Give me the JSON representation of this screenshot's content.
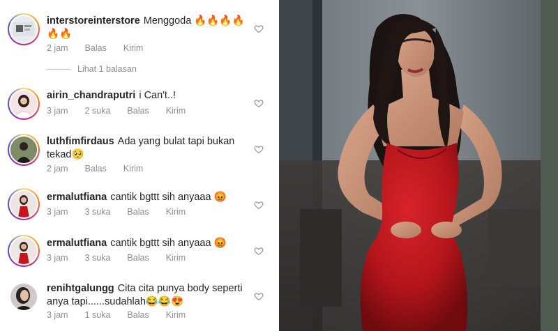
{
  "comments": [
    {
      "username": "interstoreinterstore",
      "text": "Menggoda 🔥🔥🔥🔥🔥🔥",
      "time": "2 jam",
      "likes": "",
      "reply": "Balas",
      "send": "Kirim"
    },
    {
      "username": "airin_chandraputri",
      "text": "i Can't..!",
      "time": "3 jam",
      "likes": "2 suka",
      "reply": "Balas",
      "send": "Kirim"
    },
    {
      "username": "luthfimfirdaus",
      "text": "Ada yang bulat tapi bukan tekad🥺",
      "time": "2 jam",
      "likes": "",
      "reply": "Balas",
      "send": "Kirim"
    },
    {
      "username": "ermalutfiana",
      "text": "cantik bgttt sih anyaaa 😡",
      "time": "3 jam",
      "likes": "3 suka",
      "reply": "Balas",
      "send": "Kirim"
    },
    {
      "username": "ermalutfiana",
      "text": "cantik bgttt sih anyaaa 😡",
      "time": "3 jam",
      "likes": "3 suka",
      "reply": "Balas",
      "send": "Kirim"
    },
    {
      "username": "renihtgalungg",
      "text": "Cita cita punya body seperti anya tapi......sudahlah😂😂😍",
      "time": "3 jam",
      "likes": "1 suka",
      "reply": "Balas",
      "send": "Kirim"
    }
  ],
  "view_replies": "Lihat 1 balasan",
  "colors": {
    "meta": "#8e8e8e",
    "text": "#262626",
    "dress": "#b3151b"
  },
  "icons": {
    "like": "heart-outline-icon"
  }
}
